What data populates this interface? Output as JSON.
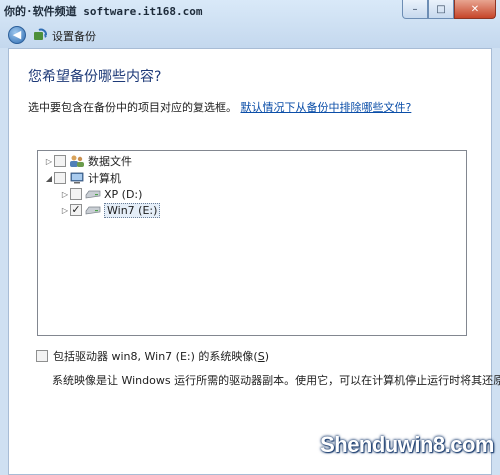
{
  "watermark_top": "你的·软件频道 software.it168.com",
  "window": {
    "title": "设置备份",
    "controls": {
      "minimize": "–",
      "maximize": "□",
      "close": "✕"
    }
  },
  "nav": {
    "back_icon": "back-arrow-icon",
    "app_icon": "backup-icon"
  },
  "heading": "您希望备份哪些内容?",
  "instruction": {
    "text": "选中要包含在备份中的项目对应的复选框。",
    "link": "默认情况下从备份中排除哪些文件?"
  },
  "tree": {
    "items": [
      {
        "label": "数据文件",
        "expander": "▷",
        "icon": "users-icon",
        "checked": false
      },
      {
        "label": "计算机",
        "expander": "◢",
        "icon": "computer-icon",
        "checked": false
      },
      {
        "label": "XP (D:)",
        "expander": "▷",
        "icon": "drive-icon",
        "checked": false
      },
      {
        "label": "Win7 (E:)",
        "expander": "▷",
        "icon": "drive-icon",
        "checked": true,
        "check_mark": "✓"
      }
    ]
  },
  "system_image": {
    "label": "包括驱动器 win8, Win7 (E:) 的系统映像(",
    "shortcut": "S",
    "label_end": ")",
    "checked": false,
    "description": "系统映像是让 Windows 运行所需的驱动器副本。使用它，可以在计算机停止运行时将其还原。"
  },
  "watermark_bottom": "Shenduwin8.com",
  "colors": {
    "heading": "#1e3a78",
    "link": "#0b4ea8",
    "frame": "#cfe0f2"
  }
}
